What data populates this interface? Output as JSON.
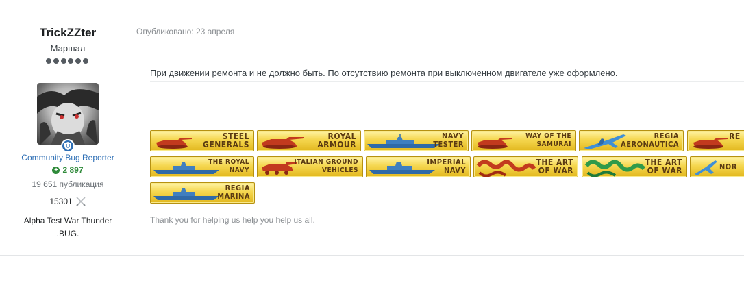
{
  "author": {
    "username": "TrickZZter",
    "rank": "Маршал",
    "group": "Community Bug Reporter",
    "reputation": "2 897",
    "posts": "19 651 публикация",
    "squadron_score": "15301",
    "signature_line1": "Alpha Test War Thunder",
    "signature_line2": ".BUG."
  },
  "post": {
    "date": "Опубликовано: 23 апреля",
    "text": "При движении ремонта и не должно быть. По отсутствию ремонта при выключенном двигателе уже оформлено.",
    "signature": "Thank you for helping us help you help us all."
  },
  "awards": [
    {
      "line1": "STEEL",
      "line2": "GENERALS",
      "icon": "tank-red"
    },
    {
      "line1": "ROYAL",
      "line2": "ARMOUR",
      "icon": "tank-red"
    },
    {
      "line1": "NAVY",
      "line2": "TESTER",
      "icon": "ship-blue"
    },
    {
      "line1": "WAY OF THE",
      "line2": "SAMURAI",
      "icon": "tank-red"
    },
    {
      "line1": "REGIA",
      "line2": "AERONAUTICA",
      "icon": "plane-blue"
    },
    {
      "line1": "RE",
      "line2": "",
      "icon": "tank-red"
    },
    {
      "line1": "THE ROYAL",
      "line2": "NAVY",
      "icon": "ship-blue"
    },
    {
      "line1": "ITALIAN GROUND",
      "line2": "VEHICLES",
      "icon": "tank-red"
    },
    {
      "line1": "IMPERIAL",
      "line2": "NAVY",
      "icon": "ship-blue"
    },
    {
      "line1": "THE ART",
      "line2": "OF WAR",
      "icon": "dragon-red"
    },
    {
      "line1": "THE ART",
      "line2": "OF WAR",
      "icon": "dragon-green"
    },
    {
      "line1": "NOR",
      "line2": "",
      "icon": "plane-blue"
    },
    {
      "line1": "REGIA",
      "line2": "MARINA",
      "icon": "ship-blue"
    }
  ]
}
